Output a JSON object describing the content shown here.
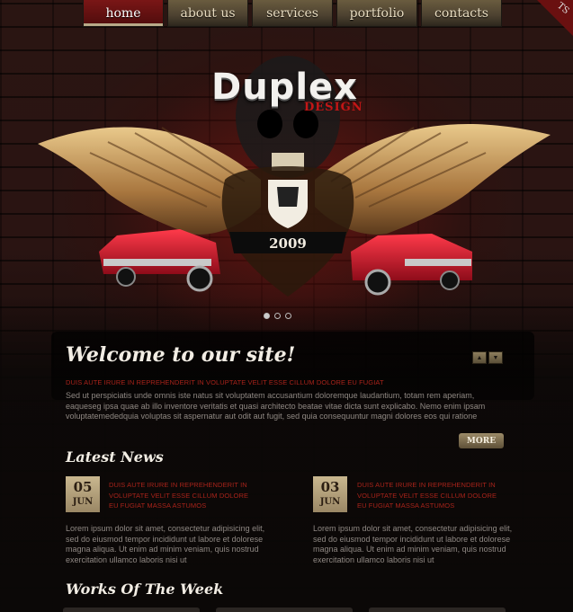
{
  "nav": {
    "items": [
      {
        "label": "home",
        "active": true
      },
      {
        "label": "about us",
        "active": false
      },
      {
        "label": "services",
        "active": false
      },
      {
        "label": "portfolio",
        "active": false
      },
      {
        "label": "contacts",
        "active": false
      }
    ]
  },
  "corner_label": "TS",
  "hero": {
    "logo_text": "Duplex",
    "logo_sub": "DESIGN",
    "year": "2009",
    "slider_dots": 3,
    "active_dot": 0
  },
  "welcome": {
    "title": "Welcome to our site!",
    "subtitle": "DUIS AUTE IRURE IN REPREHENDERIT IN VOLUPTATE VELIT ESSE CILLUM DOLORE EU FUGIAT",
    "body": "Sed ut perspiciatis unde omnis iste natus sit voluptatem accusantium doloremque laudantium, totam rem aperiam, eaqueseg ipsa quae ab illo inventore veritatis et quasi architecto beatae vitae dicta sunt explicabo. Nemo enim ipsam voluptatemededquia voluptas sit aspernatur aut odit aut fugit, sed quia consequuntur magni dolores eos qui ratione",
    "more_label": "MORE"
  },
  "news": {
    "title": "Latest News",
    "items": [
      {
        "day": "05",
        "month": "JUN",
        "headline": "DUIS AUTE IRURE IN REPREHENDERIT IN VOLUPTATE VELIT ESSE CILLUM DOLORE EU FUGIAT  MASSA ASTUMOS",
        "body": "Lorem ipsum dolor sit amet, consectetur adipisicing elit, sed do eiusmod tempor incididunt ut labore et dolorese magna aliqua. Ut enim ad minim veniam, quis nostrud exercitation ullamco laboris nisi ut"
      },
      {
        "day": "03",
        "month": "JUN",
        "headline": "DUIS AUTE IRURE IN REPREHENDERIT IN VOLUPTATE VELIT ESSE CILLUM DOLORE EU FUGIAT  MASSA ASTUMOS",
        "body": "Lorem ipsum dolor sit amet, consectetur adipisicing elit, sed do eiusmod tempor incididunt ut labore et dolorese magna aliqua. Ut enim ad minim veniam, quis nostrud exercitation ullamco laboris nisi ut"
      }
    ]
  },
  "works": {
    "title": "Works Of The Week"
  },
  "colors": {
    "accent_red": "#a8231a",
    "gold": "#b8a57d",
    "background": "#0b0807"
  }
}
